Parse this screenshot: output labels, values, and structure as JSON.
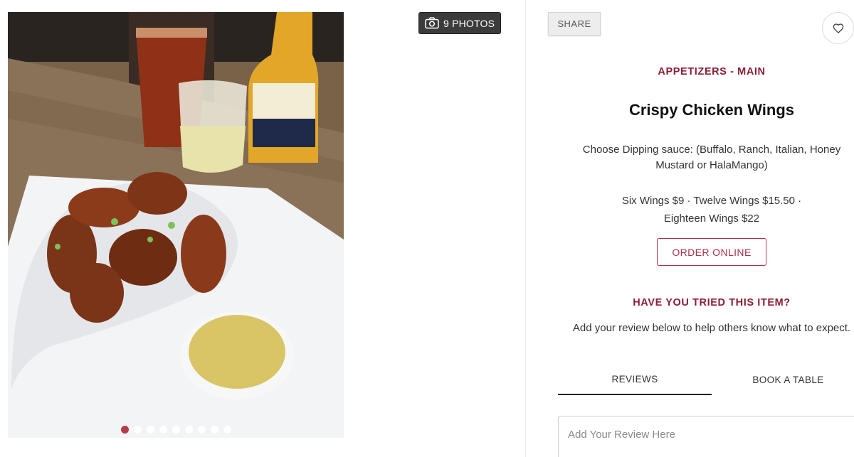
{
  "gallery": {
    "photo_alt": "Crispy Chicken Wings",
    "photos_button_label": "9 PHOTOS",
    "photo_count": 9,
    "active_index": 0
  },
  "actions": {
    "share_label": "SHARE",
    "favorite_icon": "heart-icon"
  },
  "item": {
    "category": "APPETIZERS - MAIN",
    "name": "Crispy Chicken Wings",
    "description": "Choose Dipping sauce: (Buffalo, Ranch, Italian, Honey Mustard or HalaMango)",
    "prices_line1": "Six Wings $9 ·  Twelve Wings $15.50 ·",
    "prices_line2": "Eighteen Wings $22",
    "order_label": "ORDER ONLINE"
  },
  "review": {
    "heading": "HAVE YOU TRIED THIS ITEM?",
    "help_text": "Add your review below to help others know what to expect.",
    "placeholder": "Add Your Review Here"
  },
  "tabs": [
    {
      "label": "REVIEWS",
      "active": true
    },
    {
      "label": "BOOK A TABLE",
      "active": false
    }
  ],
  "colors": {
    "accent": "#8a1d36",
    "active_dot": "#b0323f",
    "photos_button_bg": "#3b3b3b"
  }
}
